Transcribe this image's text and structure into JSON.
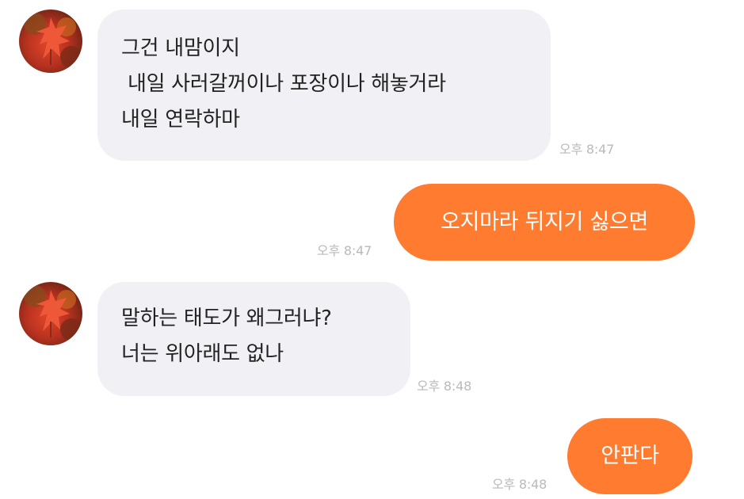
{
  "messages": [
    {
      "side": "received",
      "lines": [
        "그건 내맘이지",
        " 내일 사러갈꺼이나 포장이나 해놓거라",
        "내일 연락하마"
      ],
      "time": "오후 8:47"
    },
    {
      "side": "sent",
      "lines": [
        "오지마라 뒤지기 싫으면"
      ],
      "time": "오후 8:47"
    },
    {
      "side": "received",
      "lines": [
        "말하는 태도가 왜그러냐?",
        "너는 위아래도 없나"
      ],
      "time": "오후 8:48"
    },
    {
      "side": "sent",
      "lines": [
        "안판다"
      ],
      "time": "오후 8:48"
    }
  ],
  "icons": {
    "avatar": "autumn-maple-leaf-avatar"
  },
  "colors": {
    "sent_bubble": "#fe7b2f",
    "received_bubble": "#f1f1f5",
    "timestamp": "#b9b9bf"
  }
}
